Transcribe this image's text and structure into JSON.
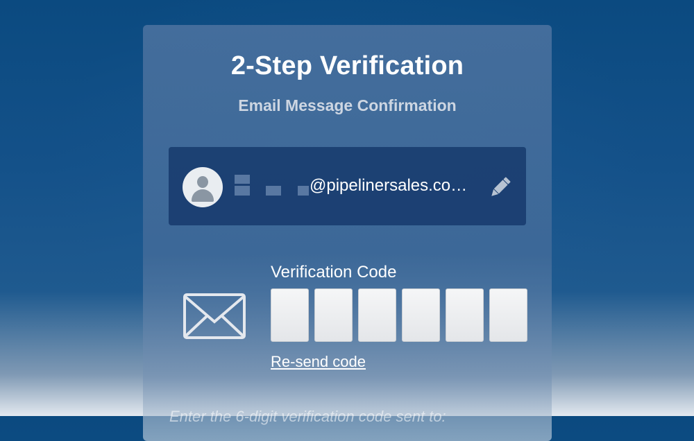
{
  "header": {
    "title": "2-Step Verification",
    "subtitle": "Email Message Confirmation"
  },
  "account": {
    "email_visible": "@pipelinersales.co…",
    "avatar_icon": "user-avatar-icon",
    "edit_icon": "pencil-icon"
  },
  "verification": {
    "label": "Verification Code",
    "digits": [
      "",
      "",
      "",
      "",
      "",
      ""
    ],
    "resend_label": "Re-send code",
    "mail_icon": "envelope-icon"
  },
  "footer": {
    "instruction": "Enter the 6-digit verification code sent to:"
  }
}
